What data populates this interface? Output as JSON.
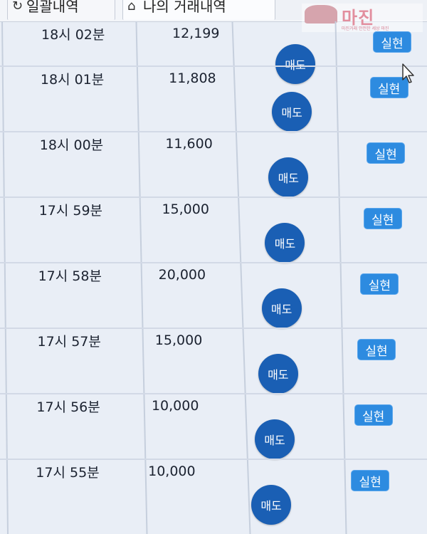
{
  "tabs": [
    {
      "label": "일괄내역",
      "icon": "clock-icon"
    },
    {
      "label": "나의 거래내역",
      "icon": "person-icon"
    }
  ],
  "watermark": {
    "brand": "마진",
    "sub": "마진거래 안전한 세상 마진"
  },
  "colors": {
    "sell": "#1a5fb4",
    "real": "#2d8be0"
  },
  "rows": [
    {
      "time": "18시 02분",
      "amount": "12,199",
      "type": "매도",
      "status": "실현"
    },
    {
      "time": "18시 01분",
      "amount": "11,808",
      "type": "매도",
      "status": "실현"
    },
    {
      "time": "18시 00분",
      "amount": "11,600",
      "type": "매도",
      "status": "실현"
    },
    {
      "time": "17시 59분",
      "amount": "15,000",
      "type": "매도",
      "status": "실현"
    },
    {
      "time": "17시 58분",
      "amount": "20,000",
      "type": "매도",
      "status": "실현"
    },
    {
      "time": "17시 57분",
      "amount": "15,000",
      "type": "매도",
      "status": "실현"
    },
    {
      "time": "17시 56분",
      "amount": "10,000",
      "type": "매도",
      "status": "실현"
    },
    {
      "time": "17시 55분",
      "amount": "10,000",
      "type": "매도",
      "status": "실현"
    }
  ]
}
